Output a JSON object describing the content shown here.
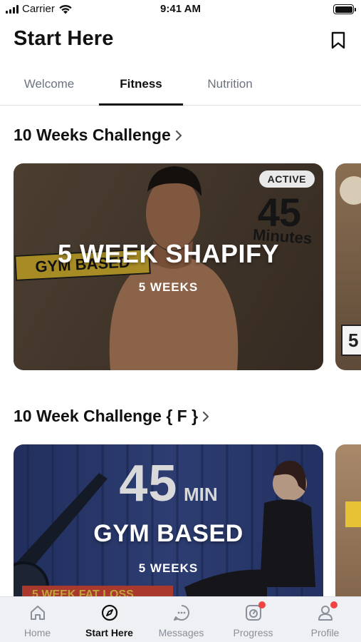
{
  "status_bar": {
    "carrier": "Carrier",
    "time": "9:41 AM"
  },
  "header": {
    "title": "Start Here"
  },
  "tabs": [
    {
      "label": "Welcome"
    },
    {
      "label": "Fitness"
    },
    {
      "label": "Nutrition"
    }
  ],
  "sections": [
    {
      "title": "10 Weeks Challenge",
      "card": {
        "badge": "ACTIVE",
        "title": "5 WEEK SHAPIFY",
        "subtitle": "5 WEEKS",
        "poster_text_number": "45",
        "poster_text_unit": "Minutes",
        "poster_banner": "GYM BASED",
        "peek_text": "5"
      }
    },
    {
      "title": "10 Week Challenge { F }",
      "card": {
        "big_number": "45",
        "big_unit": "MIN",
        "title": "GYM BASED",
        "subtitle": "5 WEEKS",
        "poster_banner": "5 WEEK FAT LOSS"
      }
    }
  ],
  "tabbar": [
    {
      "label": "Home",
      "icon": "home-icon"
    },
    {
      "label": "Start Here",
      "icon": "compass-icon",
      "active": true
    },
    {
      "label": "Messages",
      "icon": "messages-icon"
    },
    {
      "label": "Progress",
      "icon": "progress-icon",
      "badge": true
    },
    {
      "label": "Profile",
      "icon": "profile-icon",
      "badge": true
    }
  ]
}
